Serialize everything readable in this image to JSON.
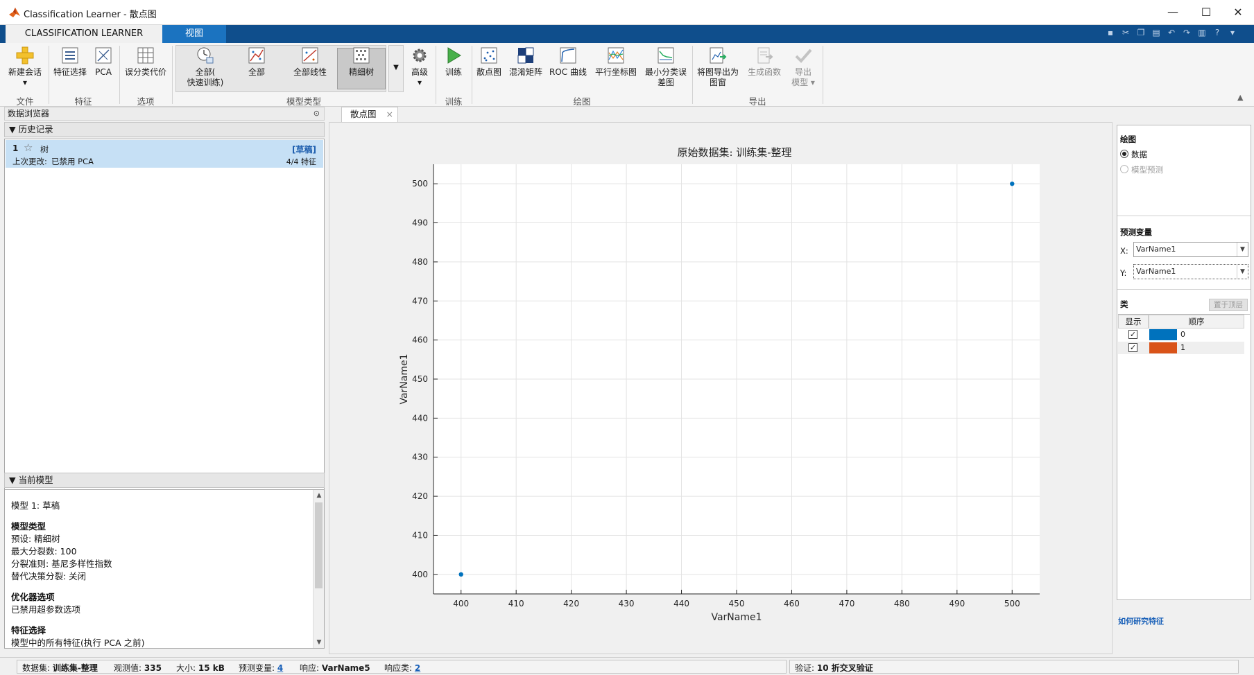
{
  "window": {
    "title": "Classification Learner - 散点图",
    "controls": [
      "—",
      "☐",
      "✕"
    ]
  },
  "ribbon_tabs": [
    {
      "label": "CLASSIFICATION LEARNER",
      "active": true
    },
    {
      "label": "视图",
      "active": false
    }
  ],
  "ribbon": {
    "file": {
      "group": "文件",
      "new_session": "新建会话"
    },
    "features": {
      "group": "特征",
      "feature_selection": "特征选择",
      "pca": "PCA"
    },
    "options": {
      "group": "选项",
      "misclassification_costs": "误分类代价"
    },
    "model_type": {
      "group": "模型类型",
      "all_quick_line1": "全部(",
      "all_quick_line2": "快速训练)",
      "all": "全部",
      "all_linear": "全部线性",
      "fine_tree": "精细树",
      "advanced": "高级"
    },
    "training": {
      "group": "训练",
      "train": "训练"
    },
    "plots": {
      "group": "绘图",
      "scatter": "散点图",
      "confusion": "混淆矩阵",
      "roc": "ROC 曲线",
      "parallel": "平行坐标图",
      "min_error_line1": "最小分类误",
      "min_error_line2": "差图"
    },
    "export": {
      "group": "导出",
      "export_plot_line1": "将图导出为",
      "export_plot_line2": "图窗",
      "generate_function": "生成函数",
      "export_model_line1": "导出",
      "export_model_line2": "模型 ▾"
    }
  },
  "data_browser": {
    "title": "数据浏览器",
    "history_header": "历史记录",
    "history": [
      {
        "index": "1",
        "name": "树",
        "status": "[草稿]",
        "last_change_label": "上次更改:",
        "last_change": "已禁用 PCA",
        "features": "4/4 特征"
      }
    ],
    "current_model_header": "当前模型",
    "current_model_lines": [
      {
        "text": "模型 1: 草稿",
        "bold": false
      },
      {
        "text": "模型类型",
        "bold": true
      },
      {
        "text": "预设: 精细树",
        "bold": false
      },
      {
        "text": "最大分裂数: 100",
        "bold": false
      },
      {
        "text": "分裂准则: 基尼多样性指数",
        "bold": false
      },
      {
        "text": "替代决策分裂: 关闭",
        "bold": false
      },
      {
        "text": "优化器选项",
        "bold": true
      },
      {
        "text": "已禁用超参数选项",
        "bold": false
      },
      {
        "text": "特征选择",
        "bold": true
      },
      {
        "text": "模型中的所有特征(执行 PCA 之前)",
        "bold": false
      }
    ]
  },
  "document_tab": {
    "label": "散点图",
    "close": "×"
  },
  "chart_data": {
    "type": "scatter",
    "title": "原始数据集: 训练集-整理",
    "xlabel": "VarName1",
    "ylabel": "VarName1",
    "xlim": [
      395,
      505
    ],
    "ylim": [
      395,
      505
    ],
    "xticks": [
      400,
      410,
      420,
      430,
      440,
      450,
      460,
      470,
      480,
      490,
      500
    ],
    "yticks": [
      400,
      410,
      420,
      430,
      440,
      450,
      460,
      470,
      480,
      490,
      500
    ],
    "grid": true,
    "series": [
      {
        "color": "#0072BD",
        "points": [
          [
            400,
            400
          ],
          [
            500,
            500
          ]
        ]
      }
    ]
  },
  "plot_options": {
    "plot_header": "绘图",
    "radio_data": "数据",
    "radio_predictions": "模型预测",
    "predictors_header": "预测变量",
    "x_label": "X:",
    "x_value": "VarName1",
    "y_label": "Y:",
    "y_value": "VarName1",
    "classes_header": "类",
    "move_to_top": "置于顶层",
    "col_show": "显示",
    "col_order": "顺序",
    "classes": [
      {
        "name": "0",
        "color": "#0072BD",
        "shown": true
      },
      {
        "name": "1",
        "color": "#D95319",
        "shown": true
      }
    ],
    "help_link": "如何研究特征"
  },
  "status": {
    "dataset_label": "数据集:",
    "dataset": "训练集-整理",
    "obs_label": "观测值:",
    "obs": "335",
    "size_label": "大小:",
    "size": "15 kB",
    "predictors_label": "预测变量:",
    "predictors": "4",
    "response_label": "响应:",
    "response": "VarName5",
    "response_classes_label": "响应类:",
    "response_classes": "2",
    "validation_label": "验证:",
    "validation": "10 折交叉验证"
  }
}
